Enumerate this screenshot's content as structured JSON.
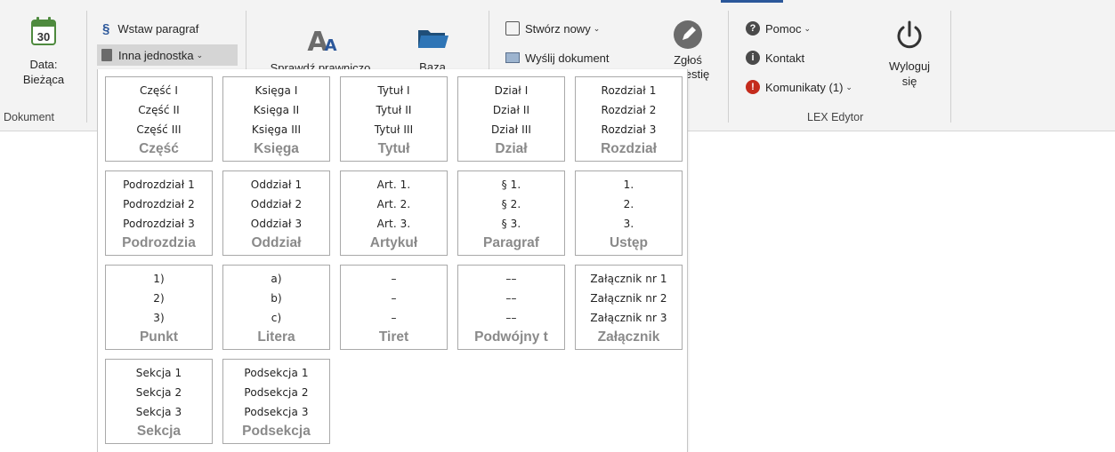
{
  "ribbon": {
    "dokument": {
      "date_button_label_1": "Data:",
      "date_button_label_2": "Bieżąca",
      "calendar_day": "30",
      "group_label": "Dokument"
    },
    "insert": {
      "paragraph_label": "Wstaw paragraf",
      "paragraph_icon": "§",
      "other_unit_label": "Inna jednostka",
      "check_label": "Sprawdź prawniczo",
      "base_label": "Baza"
    },
    "create": {
      "new_label": "Stwórz nowy",
      "send_label": "Wyślij dokument",
      "report_label_1": "Zgłoś",
      "report_label_2": "sugestię"
    },
    "lex": {
      "help_label": "Pomoc",
      "contact_label": "Kontakt",
      "messages_label": "Komunikaty (1)",
      "logout_label_1": "Wyloguj",
      "logout_label_2": "się",
      "group_label": "LEX Edytor"
    },
    "colors": {
      "accent": "#2b579a",
      "alert_red": "#c42b1c",
      "calendar_green": "#4e8a3e"
    }
  },
  "dropdown": {
    "tiles": [
      {
        "lines": [
          "Część I",
          "Część II",
          "Część III"
        ],
        "name": "Część"
      },
      {
        "lines": [
          "Księga I",
          "Księga II",
          "Księga III"
        ],
        "name": "Księga"
      },
      {
        "lines": [
          "Tytuł I",
          "Tytuł II",
          "Tytuł III"
        ],
        "name": "Tytuł"
      },
      {
        "lines": [
          "Dział I",
          "Dział II",
          "Dział III"
        ],
        "name": "Dział"
      },
      {
        "lines": [
          "Rozdział 1",
          "Rozdział 2",
          "Rozdział 3"
        ],
        "name": "Rozdział"
      },
      {
        "lines": [
          "Podrozdział 1",
          "Podrozdział 2",
          "Podrozdział 3"
        ],
        "name": "Podrozdzia"
      },
      {
        "lines": [
          "Oddział 1",
          "Oddział 2",
          "Oddział 3"
        ],
        "name": "Oddział"
      },
      {
        "lines": [
          "Art. 1.",
          "Art. 2.",
          "Art. 3."
        ],
        "name": "Artykuł"
      },
      {
        "lines": [
          "§ 1.",
          "§ 2.",
          "§ 3."
        ],
        "name": "Paragraf"
      },
      {
        "lines": [
          "1.",
          "2.",
          "3."
        ],
        "name": "Ustęp"
      },
      {
        "lines": [
          "1)",
          "2)",
          "3)"
        ],
        "name": "Punkt"
      },
      {
        "lines": [
          "a)",
          "b)",
          "c)"
        ],
        "name": "Litera"
      },
      {
        "lines": [
          "–",
          "–",
          "–"
        ],
        "name": "Tiret"
      },
      {
        "lines": [
          "––",
          "––",
          "––"
        ],
        "name": "Podwójny t"
      },
      {
        "lines": [
          "Załącznik nr 1",
          "Załącznik nr 2",
          "Załącznik nr 3"
        ],
        "name": "Załącznik"
      },
      {
        "lines": [
          "Sekcja 1",
          "Sekcja 2",
          "Sekcja 3"
        ],
        "name": "Sekcja"
      },
      {
        "lines": [
          "Podsekcja 1",
          "Podsekcja 2",
          "Podsekcja 3"
        ],
        "name": "Podsekcja"
      }
    ]
  }
}
